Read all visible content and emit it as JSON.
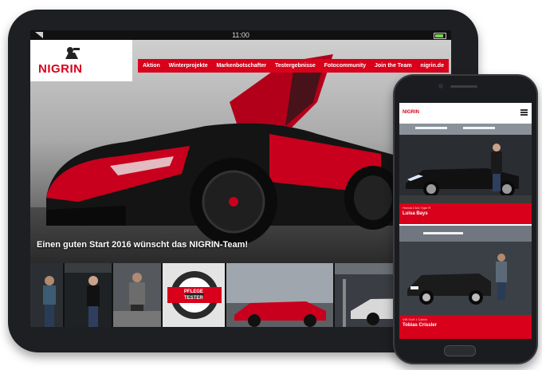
{
  "tablet": {
    "status_time": "11:00",
    "logo_text": "NIGRIN",
    "nav": [
      "Aktion",
      "Winterprojekte",
      "Markenbotschafter",
      "Testergebnisse",
      "Fotocommunity",
      "Join the Team",
      "nigrin.de"
    ],
    "hero_caption": "Einen guten Start 2016 wünscht das NIGRIN-Team!",
    "badge": {
      "line1": "PFLEGE",
      "line2": "TESTER"
    }
  },
  "phone": {
    "logo_text": "NIGRIN",
    "cards": [
      {
        "subtitle": "Honda Civic Type R",
        "title": "Luisa Bays"
      },
      {
        "subtitle": "VW Golf 1 Cabrio",
        "title": "Tobias Crissler"
      }
    ]
  },
  "colors": {
    "brand_red": "#d9001b",
    "device_body": "#1d1f22",
    "battery_green": "#79d24b"
  }
}
